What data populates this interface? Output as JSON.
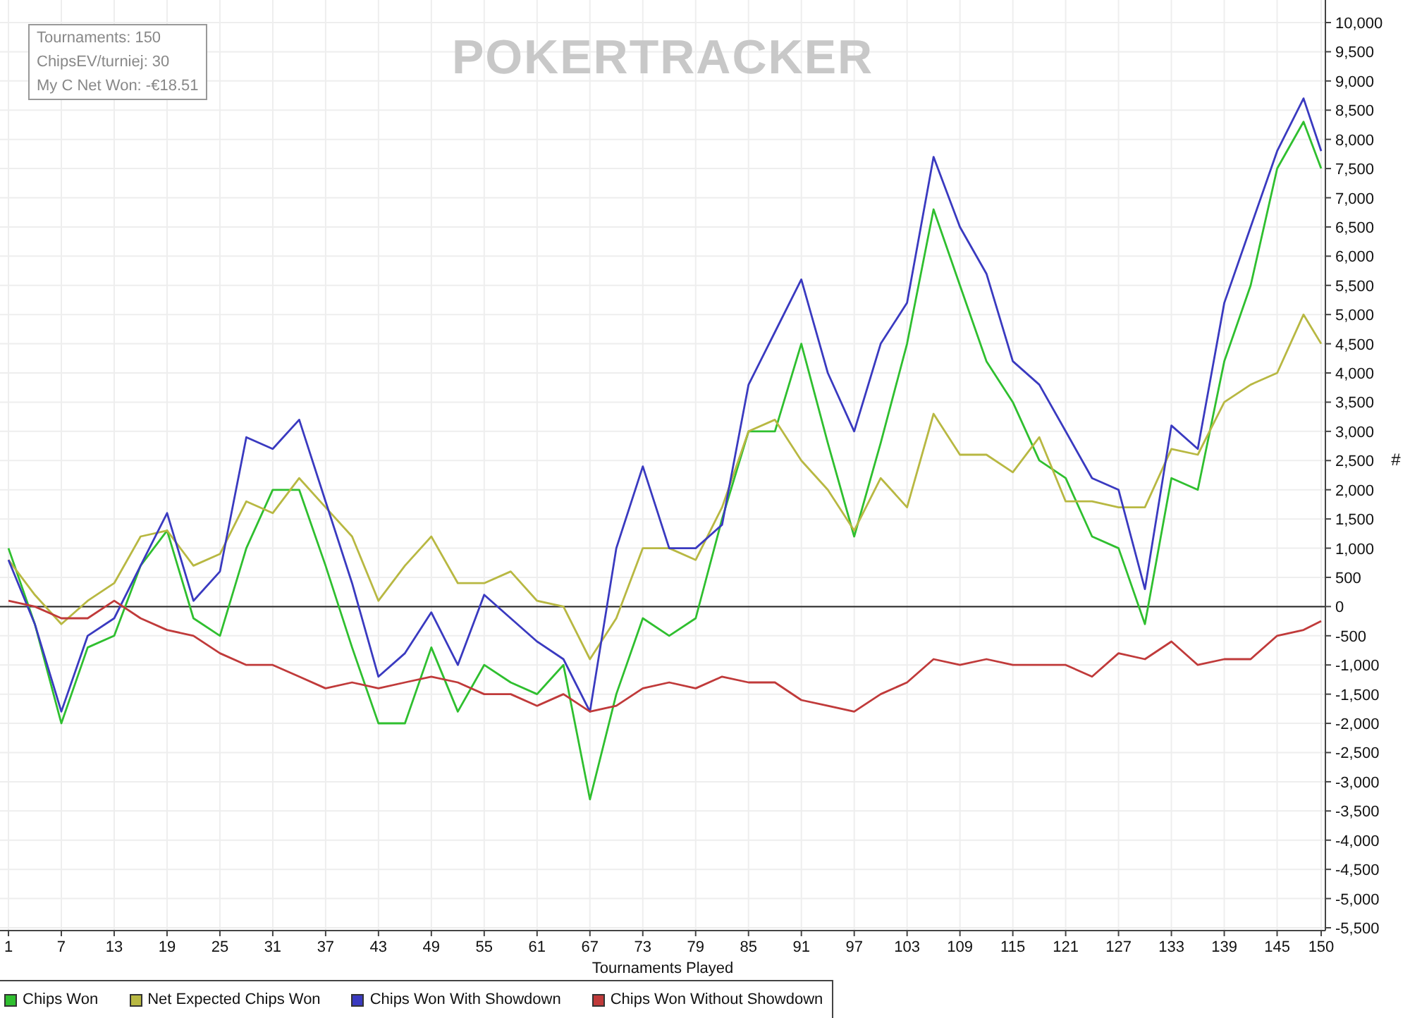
{
  "watermark": "POKERTRACKER",
  "stats_box": [
    "Tournaments: 150",
    "ChipsEV/turniej: 30",
    "My C Net Won: -€18.51"
  ],
  "chart": {
    "chart_data": {
      "type": "line",
      "grid": true,
      "xlabel": "Tournaments Played",
      "ylabel": "#",
      "x": [
        1,
        4,
        7,
        10,
        13,
        16,
        19,
        22,
        25,
        28,
        31,
        34,
        37,
        40,
        43,
        46,
        49,
        52,
        55,
        58,
        61,
        64,
        67,
        70,
        73,
        76,
        79,
        82,
        85,
        88,
        91,
        94,
        97,
        100,
        103,
        106,
        109,
        112,
        115,
        118,
        121,
        124,
        127,
        130,
        133,
        136,
        139,
        142,
        145,
        148,
        150
      ],
      "series": [
        {
          "name": "Chips Won",
          "color": "#2fbf2f",
          "values": [
            1000,
            -300,
            -2000,
            -700,
            -500,
            700,
            1300,
            -200,
            -500,
            1000,
            2000,
            2000,
            700,
            -700,
            -2000,
            -2000,
            -700,
            -1800,
            -1000,
            -1300,
            -1500,
            -1000,
            -3300,
            -1500,
            -200,
            -500,
            -200,
            1500,
            3000,
            3000,
            4500,
            2800,
            1200,
            2800,
            4500,
            6800,
            5500,
            4200,
            3500,
            2500,
            2200,
            1200,
            1000,
            -300,
            2200,
            2000,
            4200,
            5500,
            7500,
            8300,
            7500
          ]
        },
        {
          "name": "Net Expected Chips Won",
          "color": "#b8b842",
          "values": [
            800,
            200,
            -300,
            100,
            400,
            1200,
            1300,
            700,
            900,
            1800,
            1600,
            2200,
            1700,
            1200,
            100,
            700,
            1200,
            400,
            400,
            600,
            100,
            0,
            -900,
            -200,
            1000,
            1000,
            800,
            1700,
            3000,
            3200,
            2500,
            2000,
            1300,
            2200,
            1700,
            3300,
            2600,
            2600,
            2300,
            2900,
            1800,
            1800,
            1700,
            1700,
            2700,
            2600,
            3500,
            3800,
            4000,
            5000,
            4500
          ]
        },
        {
          "name": "Chips Won With Showdown",
          "color": "#3a3ac0",
          "values": [
            800,
            -300,
            -1800,
            -500,
            -200,
            700,
            1600,
            100,
            600,
            2900,
            2700,
            3200,
            1800,
            400,
            -1200,
            -800,
            -100,
            -1000,
            200,
            -200,
            -600,
            -900,
            -1800,
            1000,
            2400,
            1000,
            1000,
            1400,
            3800,
            4700,
            5600,
            4000,
            3000,
            4500,
            5200,
            7700,
            6500,
            5700,
            4200,
            3800,
            3000,
            2200,
            2000,
            300,
            3100,
            2700,
            5200,
            6500,
            7800,
            8700,
            7800
          ]
        },
        {
          "name": "Chips Won Without Showdown",
          "color": "#c03a3a",
          "values": [
            100,
            0,
            -200,
            -200,
            100,
            -200,
            -400,
            -500,
            -800,
            -1000,
            -1000,
            -1200,
            -1400,
            -1300,
            -1400,
            -1300,
            -1200,
            -1300,
            -1500,
            -1500,
            -1700,
            -1500,
            -1800,
            -1700,
            -1400,
            -1300,
            -1400,
            -1200,
            -1300,
            -1300,
            -1600,
            -1700,
            -1800,
            -1500,
            -1300,
            -900,
            -1000,
            -900,
            -1000,
            -1000,
            -1000,
            -1200,
            -800,
            -900,
            -600,
            -1000,
            -900,
            -900,
            -500,
            -400,
            -250
          ]
        }
      ],
      "xlim": [
        1,
        150
      ],
      "ylim": [
        -5500,
        10000
      ],
      "xticks": [
        1,
        7,
        13,
        19,
        25,
        31,
        37,
        43,
        49,
        55,
        61,
        67,
        73,
        79,
        85,
        91,
        97,
        103,
        109,
        115,
        121,
        127,
        133,
        139,
        145,
        150
      ],
      "yticks": [
        {
          "value": 10000,
          "label": "10,000"
        },
        {
          "value": 9500,
          "label": "9,500"
        },
        {
          "value": 9000,
          "label": "9,000"
        },
        {
          "value": 8500,
          "label": "8,500"
        },
        {
          "value": 8000,
          "label": "8,000"
        },
        {
          "value": 7500,
          "label": "7,500"
        },
        {
          "value": 7000,
          "label": "7,000"
        },
        {
          "value": 6500,
          "label": "6,500"
        },
        {
          "value": 6000,
          "label": "6,000"
        },
        {
          "value": 5500,
          "label": "5,500"
        },
        {
          "value": 5000,
          "label": "5,000"
        },
        {
          "value": 4500,
          "label": "4,500"
        },
        {
          "value": 4000,
          "label": "4,000"
        },
        {
          "value": 3500,
          "label": "3,500"
        },
        {
          "value": 3000,
          "label": "3,000"
        },
        {
          "value": 2500,
          "label": "2,500"
        },
        {
          "value": 2000,
          "label": "2,000"
        },
        {
          "value": 1500,
          "label": "1,500"
        },
        {
          "value": 1000,
          "label": "1,000"
        },
        {
          "value": 500,
          "label": "500"
        },
        {
          "value": 0,
          "label": "0"
        },
        {
          "value": -500,
          "label": "-500"
        },
        {
          "value": -1000,
          "label": "-1,000"
        },
        {
          "value": -1500,
          "label": "-1,500"
        },
        {
          "value": -2000,
          "label": "-2,000"
        },
        {
          "value": -2500,
          "label": "-2,500"
        },
        {
          "value": -3000,
          "label": "-3,000"
        },
        {
          "value": -3500,
          "label": "-3,500"
        },
        {
          "value": -4000,
          "label": "-4,000"
        },
        {
          "value": -4500,
          "label": "-4,500"
        },
        {
          "value": -5000,
          "label": "-5,000"
        },
        {
          "value": -5500,
          "label": "-5,500"
        }
      ]
    }
  }
}
